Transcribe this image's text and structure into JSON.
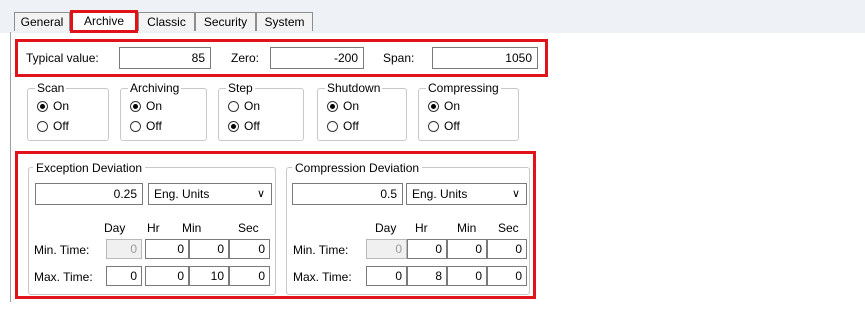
{
  "tabs": [
    "General",
    "Archive",
    "Classic",
    "Security",
    "System"
  ],
  "top_fields": {
    "typical_label": "Typical value:",
    "typical_value": "85",
    "zero_label": "Zero:",
    "zero_value": "-200",
    "span_label": "Span:",
    "span_value": "1050"
  },
  "radio_groups": [
    {
      "title": "Scan",
      "on": "On",
      "off": "Off",
      "selected": "On"
    },
    {
      "title": "Archiving",
      "on": "On",
      "off": "Off",
      "selected": "On"
    },
    {
      "title": "Step",
      "on": "On",
      "off": "Off",
      "selected": "Off"
    },
    {
      "title": "Shutdown",
      "on": "On",
      "off": "Off",
      "selected": "On"
    },
    {
      "title": "Compressing",
      "on": "On",
      "off": "Off",
      "selected": "On"
    }
  ],
  "exception": {
    "title": "Exception Deviation",
    "value": "0.25",
    "units": "Eng. Units",
    "headers": [
      "Day",
      "Hr",
      "Min",
      "Sec"
    ],
    "min_label": "Min. Time:",
    "min": [
      "0",
      "0",
      "0",
      "0"
    ],
    "max_label": "Max. Time:",
    "max": [
      "0",
      "0",
      "10",
      "0"
    ]
  },
  "compression": {
    "title": "Compression Deviation",
    "value": "0.5",
    "units": "Eng. Units",
    "headers": [
      "Day",
      "Hr",
      "Min",
      "Sec"
    ],
    "min_label": "Min. Time:",
    "min": [
      "0",
      "0",
      "0",
      "0"
    ],
    "max_label": "Max. Time:",
    "max": [
      "0",
      "8",
      "0",
      "0"
    ]
  },
  "colors": {
    "highlight": "#e0131a"
  }
}
